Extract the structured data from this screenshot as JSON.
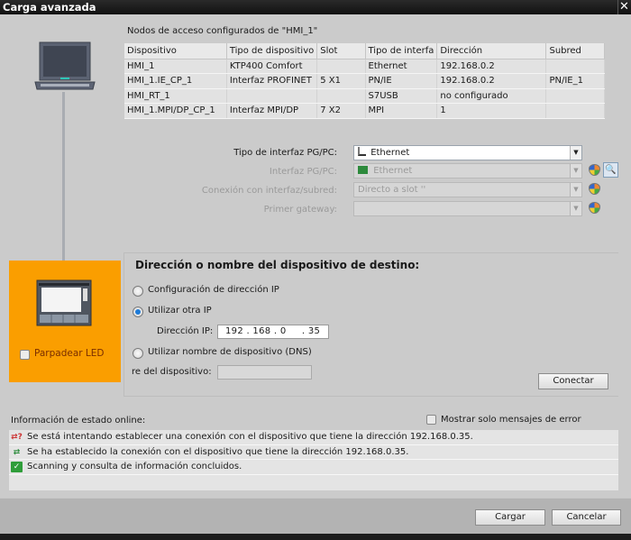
{
  "window": {
    "title": "Carga avanzada",
    "close_icon": "close-icon"
  },
  "nodes": {
    "label": "Nodos de acceso configurados de \"HMI_1\"",
    "columns": [
      "Dispositivo",
      "Tipo de dispositivo",
      "Slot",
      "Tipo de interfa",
      "Dirección",
      "Subred"
    ],
    "rows": [
      [
        "HMI_1",
        "KTP400 Comfort",
        "",
        "Ethernet",
        "192.168.0.2",
        ""
      ],
      [
        "HMI_1.IE_CP_1",
        "Interfaz PROFINET",
        "5 X1",
        "PN/IE",
        "192.168.0.2",
        "PN/IE_1"
      ],
      [
        "HMI_RT_1",
        "",
        "",
        "S7USB",
        "no configurado",
        ""
      ],
      [
        "HMI_1.MPI/DP_CP_1",
        "Interfaz MPI/DP",
        "7 X2",
        "MPI",
        "1",
        ""
      ]
    ]
  },
  "interface": {
    "type_label": "Tipo de interfaz PG/PC:",
    "type_value": "Ethernet",
    "pgpc_label": "Interfaz PG/PC:",
    "pgpc_value": "Ethernet",
    "connection_label": "Conexión con interfaz/subred:",
    "connection_value": "Directo a slot ''",
    "gateway_label": "Primer gateway:",
    "gateway_value": ""
  },
  "device": {
    "led_label": "Parpadear LED",
    "led_checked": false
  },
  "target": {
    "title": "Dirección o nombre del dispositivo de destino:",
    "opt_config_ip": "Configuración de dirección IP",
    "opt_other_ip": "Utilizar otra IP",
    "ip_label": "Dirección IP:",
    "ip_value": "192 . 168 . 0     . 35",
    "opt_dns": "Utilizar nombre de dispositivo (DNS)",
    "name_label": "re del dispositivo:",
    "name_value": "",
    "selected": "Utilizar otra IP",
    "connect_label": "Conectar"
  },
  "status": {
    "label": "Información de estado online:",
    "only_errors_label": "Mostrar solo mensajes de error",
    "only_errors_checked": false,
    "messages": [
      {
        "icon": "connecting-icon",
        "text": "Se está intentando establecer una conexión con el dispositivo que tiene la dirección 192.168.0.35."
      },
      {
        "icon": "connected-icon",
        "text": "Se ha establecido la conexión con el dispositivo que tiene la dirección 192.168.0.35."
      },
      {
        "icon": "success-check-icon",
        "text": "Scanning y consulta de información concluidos."
      }
    ]
  },
  "footer": {
    "load_label": "Cargar",
    "cancel_label": "Cancelar"
  },
  "colors": {
    "device_highlight": "#fa9e00",
    "radio_accent": "#1d7bd8",
    "success": "#2f9d3a"
  }
}
